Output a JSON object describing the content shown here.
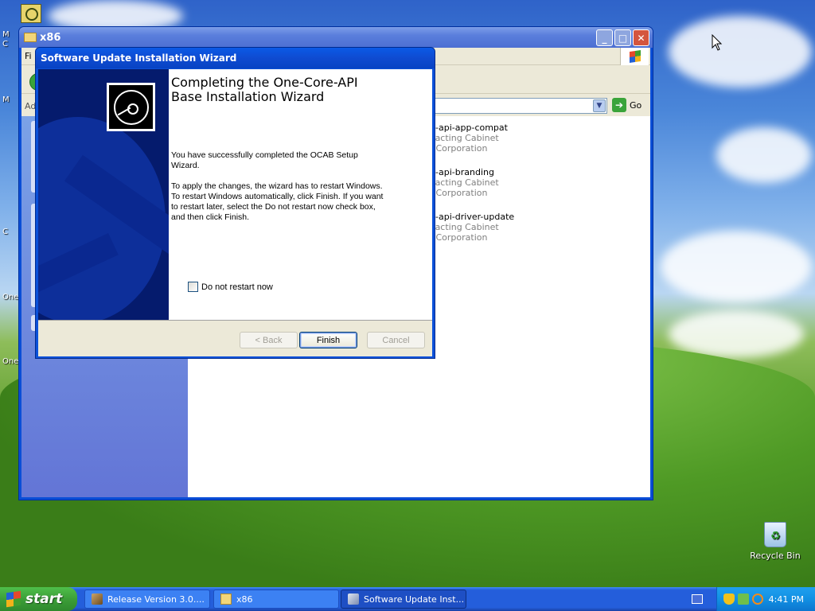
{
  "desktop": {
    "edge_labels": [
      "M",
      "C",
      "M",
      "C",
      "One",
      "One"
    ],
    "recycle_bin_label": "Recycle Bin"
  },
  "explorer": {
    "title": "x86",
    "menu_first_letter": "Fi",
    "address_label": "Ad",
    "go_label": "Go",
    "files": [
      {
        "name": "re-api-app-compat",
        "line2": "cracting Cabinet",
        "line3": "ft Corporation"
      },
      {
        "name": "re-api-branding",
        "line2": "cracting Cabinet",
        "line3": "ft Corporation"
      },
      {
        "name": "re-api-driver-update",
        "line2": "cracting Cabinet",
        "line3": "ft Corporation"
      }
    ],
    "buttons": {
      "minimize": "_",
      "maximize": "□",
      "close": "✕"
    }
  },
  "wizard": {
    "title": "Software Update Installation Wizard",
    "heading": "Completing the One-Core-API\nBase Installation Wizard",
    "paragraph1": "You have successfully completed the OCAB Setup Wizard.",
    "paragraph2": "To apply the changes, the wizard has to restart Windows. To restart Windows automatically, click Finish. If you want to restart later, select the Do not restart now check box, and then click Finish.",
    "checkbox_label": "Do not restart now",
    "checkbox_checked": false,
    "back_label": "< Back",
    "finish_label": "Finish",
    "cancel_label": "Cancel"
  },
  "taskbar": {
    "start_label": "start",
    "tasks": [
      {
        "label": "Release Version 3.0....",
        "active": false
      },
      {
        "label": "x86",
        "active": false
      },
      {
        "label": "Software Update Inst...",
        "active": true
      }
    ],
    "clock": "4:41 PM"
  },
  "colors": {
    "xp_blue": "#0b51d9",
    "start_green": "#3c9e38",
    "tray_blue": "#1290e3"
  }
}
